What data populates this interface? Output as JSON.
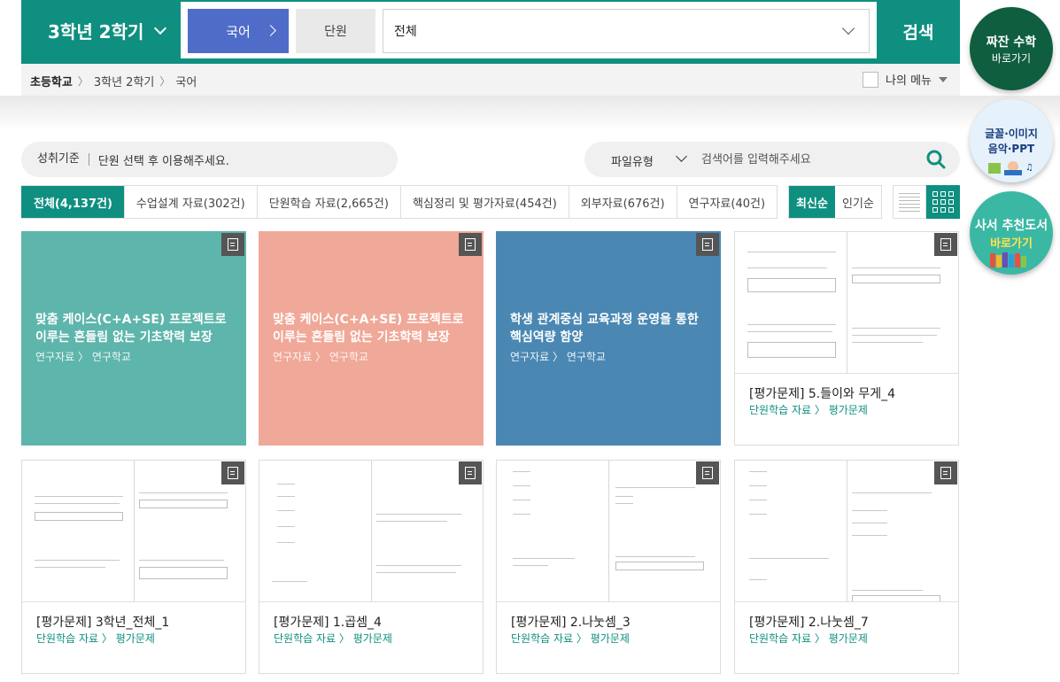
{
  "header": {
    "grade": "3학년 2학기",
    "subject": "국어",
    "unit_label": "단원",
    "unit_value": "전체",
    "search_label": "검색"
  },
  "breadcrumb": {
    "items": [
      "초등학교",
      "3학년 2학기",
      "국어"
    ],
    "my_menu": "나의 메뉴"
  },
  "side": {
    "math": {
      "line1": "짜잔 수학",
      "line2": "바로가기"
    },
    "media": {
      "line1": "글꼴·이미지",
      "line2": "음악·PPT"
    },
    "books": {
      "line1": "사서 추천도서",
      "line2": "바로가기"
    }
  },
  "standards": {
    "label": "성취기준",
    "text": "단원 선택 후 이용해주세요."
  },
  "search": {
    "file_type": "파일유형",
    "placeholder": "검색어를 입력해주세요"
  },
  "tabs": [
    {
      "label": "전체",
      "count": "(4,137건)"
    },
    {
      "label": "수업설계 자료",
      "count": "(302건)"
    },
    {
      "label": "단원학습 자료",
      "count": "(2,665건)"
    },
    {
      "label": "핵심정리 및 평가자료",
      "count": "(454건)"
    },
    {
      "label": "외부자료",
      "count": "(676건)"
    },
    {
      "label": "연구자료",
      "count": "(40건)"
    }
  ],
  "sort": {
    "latest": "최신순",
    "popular": "인기순"
  },
  "cards": [
    {
      "title": "맞춤 케이스(C+A+SE) 프로젝트로 이루는 흔들림 없는 기초학력 보장",
      "category": "연구자료",
      "sub": "연구학교",
      "color": "#5db5ab"
    },
    {
      "title": "맞춤 케이스(C+A+SE) 프로젝트로 이루는 흔들림 없는 기초학력 보장",
      "category": "연구자료",
      "sub": "연구학교",
      "color": "#f0a898"
    },
    {
      "title": "학생 관계중심 교육과정 운영을 통한 핵심역량 함양",
      "category": "연구자료",
      "sub": "연구학교",
      "color": "#4a88b3"
    },
    {
      "title": "[평가문제] 5.들이와 무게_4",
      "category": "단원학습 자료",
      "sub": "평가문제"
    },
    {
      "title": "[평가문제] 3학년_전체_1",
      "category": "단원학습 자료",
      "sub": "평가문제"
    },
    {
      "title": "[평가문제] 1.곱셈_4",
      "category": "단원학습 자료",
      "sub": "평가문제"
    },
    {
      "title": "[평가문제] 2.나눗셈_3",
      "category": "단원학습 자료",
      "sub": "평가문제"
    },
    {
      "title": "[평가문제] 2.나눗셈_7",
      "category": "단원학습 자료",
      "sub": "평가문제"
    }
  ],
  "colors": {
    "accent": "#0f8f80",
    "subject_button": "#4f6cc8"
  },
  "icons": [
    "chevron-down-icon",
    "chevron-right-icon",
    "search-icon",
    "document-icon",
    "list-view-icon",
    "grid-view-icon",
    "checkbox-icon"
  ]
}
